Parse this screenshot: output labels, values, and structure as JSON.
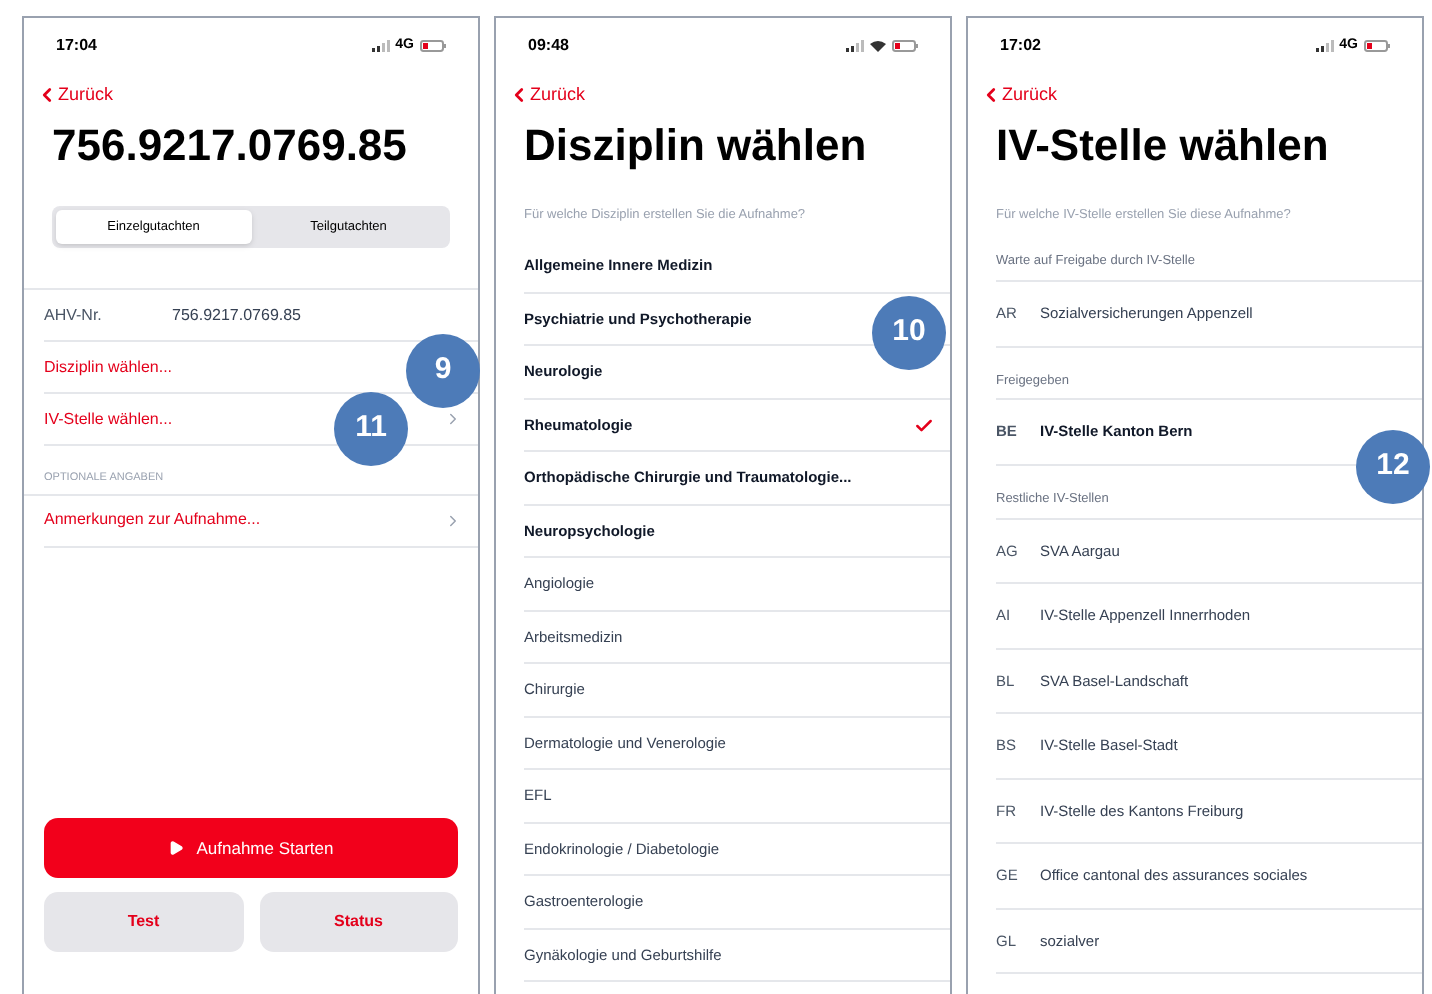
{
  "screens": [
    {
      "kind": "summary",
      "time": "17:04",
      "status_icons": [
        {
          "kind": "signal"
        },
        {
          "kind": "network",
          "label": "4G"
        },
        {
          "kind": "battery"
        }
      ],
      "back": "Zurück",
      "title": "756.9217.0769.85",
      "segments": [
        {
          "label": "Einzelgutachten",
          "selected": true
        },
        {
          "label": "Teilgutachten",
          "selected": false
        }
      ],
      "fields": [
        {
          "label": "AHV-Nr.",
          "value": "756.9217.0769.85"
        }
      ],
      "links": [
        {
          "label": "Disziplin wählen...",
          "chevron": false
        },
        {
          "label": "IV-Stelle wählen...",
          "chevron": true
        }
      ],
      "optional_header": "OPTIONALE ANGABEN",
      "optional_links": [
        {
          "label": "Anmerkungen zur Aufnahme...",
          "chevron": true
        }
      ],
      "primary_button": "Aufnahme Starten",
      "buttons": [
        "Test",
        "Status"
      ]
    },
    {
      "kind": "list",
      "time": "09:48",
      "status_icons": [
        {
          "kind": "signal"
        },
        {
          "kind": "wifi"
        },
        {
          "kind": "battery"
        }
      ],
      "back": "Zurück",
      "title": "Disziplin wählen",
      "prompt": "Für welche Disziplin erstellen Sie die Aufnahme?",
      "sections": [
        {
          "kind": "featured",
          "items": [
            {
              "label": "Allgemeine Innere Medizin",
              "selected": false
            },
            {
              "label": "Psychiatrie und Psychotherapie",
              "selected": false
            },
            {
              "label": "Neurologie",
              "selected": false
            },
            {
              "label": "Rheumatologie",
              "selected": true
            },
            {
              "label": "Orthopädische Chirurgie und Traumatologie...",
              "selected": false
            },
            {
              "label": "Neuropsychologie",
              "selected": false
            }
          ]
        },
        {
          "kind": "other",
          "items": [
            {
              "label": "Angiologie",
              "selected": false
            },
            {
              "label": "Arbeitsmedizin",
              "selected": false
            },
            {
              "label": "Chirurgie",
              "selected": false
            },
            {
              "label": "Dermatologie und Venerologie",
              "selected": false
            },
            {
              "label": "EFL",
              "selected": false
            },
            {
              "label": "Endokrinologie / Diabetologie",
              "selected": false
            },
            {
              "label": "Gastroenterologie",
              "selected": false
            },
            {
              "label": "Gynäkologie und Geburtshilfe",
              "selected": false
            }
          ]
        }
      ]
    },
    {
      "kind": "list",
      "time": "17:02",
      "status_icons": [
        {
          "kind": "signal"
        },
        {
          "kind": "network",
          "label": "4G"
        },
        {
          "kind": "battery"
        }
      ],
      "back": "Zurück",
      "title": "IV-Stelle wählen",
      "prompt": "Für welche IV-Stelle erstellen Sie diese Aufnahme?",
      "sections": [
        {
          "kind": "other",
          "header": "Warte auf Freigabe durch IV-Stelle",
          "items": [
            {
              "code": "AR",
              "label": "Sozialversicherungen Appenzell",
              "selected": false
            }
          ]
        },
        {
          "kind": "featured",
          "header": "Freigegeben",
          "items": [
            {
              "code": "BE",
              "label": "IV-Stelle Kanton Bern",
              "selected": false
            }
          ]
        },
        {
          "kind": "other",
          "header": "Restliche IV-Stellen",
          "items": [
            {
              "code": "AG",
              "label": "SVA Aargau",
              "selected": false
            },
            {
              "code": "AI",
              "label": "IV-Stelle Appenzell Innerrhoden",
              "selected": false
            },
            {
              "code": "BL",
              "label": "SVA Basel-Landschaft",
              "selected": false
            },
            {
              "code": "BS",
              "label": "IV-Stelle Basel-Stadt",
              "selected": false
            },
            {
              "code": "FR",
              "label": "IV-Stelle des Kantons Freiburg",
              "selected": false
            },
            {
              "code": "GE",
              "label": "Office cantonal des assurances sociales",
              "selected": false
            },
            {
              "code": "GL",
              "label": "sozialver",
              "selected": false
            }
          ]
        }
      ]
    }
  ],
  "callouts": [
    {
      "label": "9"
    },
    {
      "label": "11"
    },
    {
      "label": "10"
    },
    {
      "label": "12"
    }
  ]
}
